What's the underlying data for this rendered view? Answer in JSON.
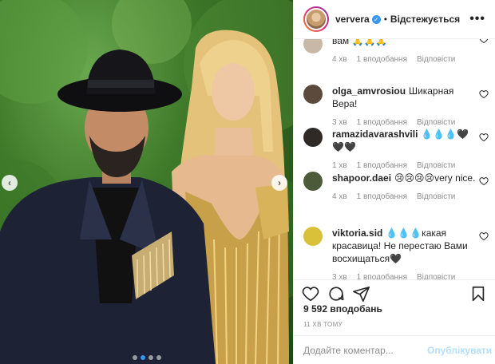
{
  "post": {
    "username": "ververa",
    "verified_icon": "verified-badge-icon",
    "separator": "•",
    "follow_status": "Відстежується",
    "more_icon": "more-options-icon"
  },
  "carousel": {
    "prev_icon": "chevron-left-icon",
    "next_icon": "chevron-right-icon",
    "slides": 4,
    "active_slide": 2
  },
  "comments": [
    {
      "username": "",
      "text": "вам 🙏🙏🙏",
      "time": "4 хв",
      "likes": "1 вподобання",
      "reply": "Відповісти",
      "avatar_color": "#c7b8a8"
    },
    {
      "username": "olga_amvrosiou",
      "text": "Шикарная Вера!",
      "time": "3 хв",
      "likes": "1 вподобання",
      "reply": "Відповісти",
      "avatar_color": "#5c4a3c"
    },
    {
      "username": "ramazidavarashvili",
      "text": "💧💧💧🖤🖤🖤",
      "time": "1 хв",
      "likes": "1 вподобання",
      "reply": "Відповісти",
      "avatar_color": "#2f2a26"
    },
    {
      "username": "shapoor.daei",
      "text": "😢😢😢😢very nice.",
      "time": "4 хв",
      "likes": "1 вподобання",
      "reply": "Відповісти",
      "avatar_color": "#4c5a3a"
    },
    {
      "username": "viktoria.sid",
      "text": "💧💧💧какая красавица! Не перестаю Вами восхищаться🖤",
      "time": "3 хв",
      "likes": "1 вподобання",
      "reply": "Відповісти",
      "avatar_color": "#d9c23a"
    }
  ],
  "actions": {
    "like_icon": "heart-icon",
    "comment_icon": "comment-icon",
    "share_icon": "share-icon",
    "save_icon": "bookmark-icon"
  },
  "likes_count": "9 592 вподобань",
  "posted_time": "11 ХВ ТОМУ",
  "add_comment": {
    "placeholder": "Додайте коментар...",
    "post_label": "Опублікувати"
  },
  "colors": {
    "accent": "#3897f0",
    "post_disabled": "#b2dffc",
    "muted": "#8e8e8e",
    "text": "#262626"
  }
}
